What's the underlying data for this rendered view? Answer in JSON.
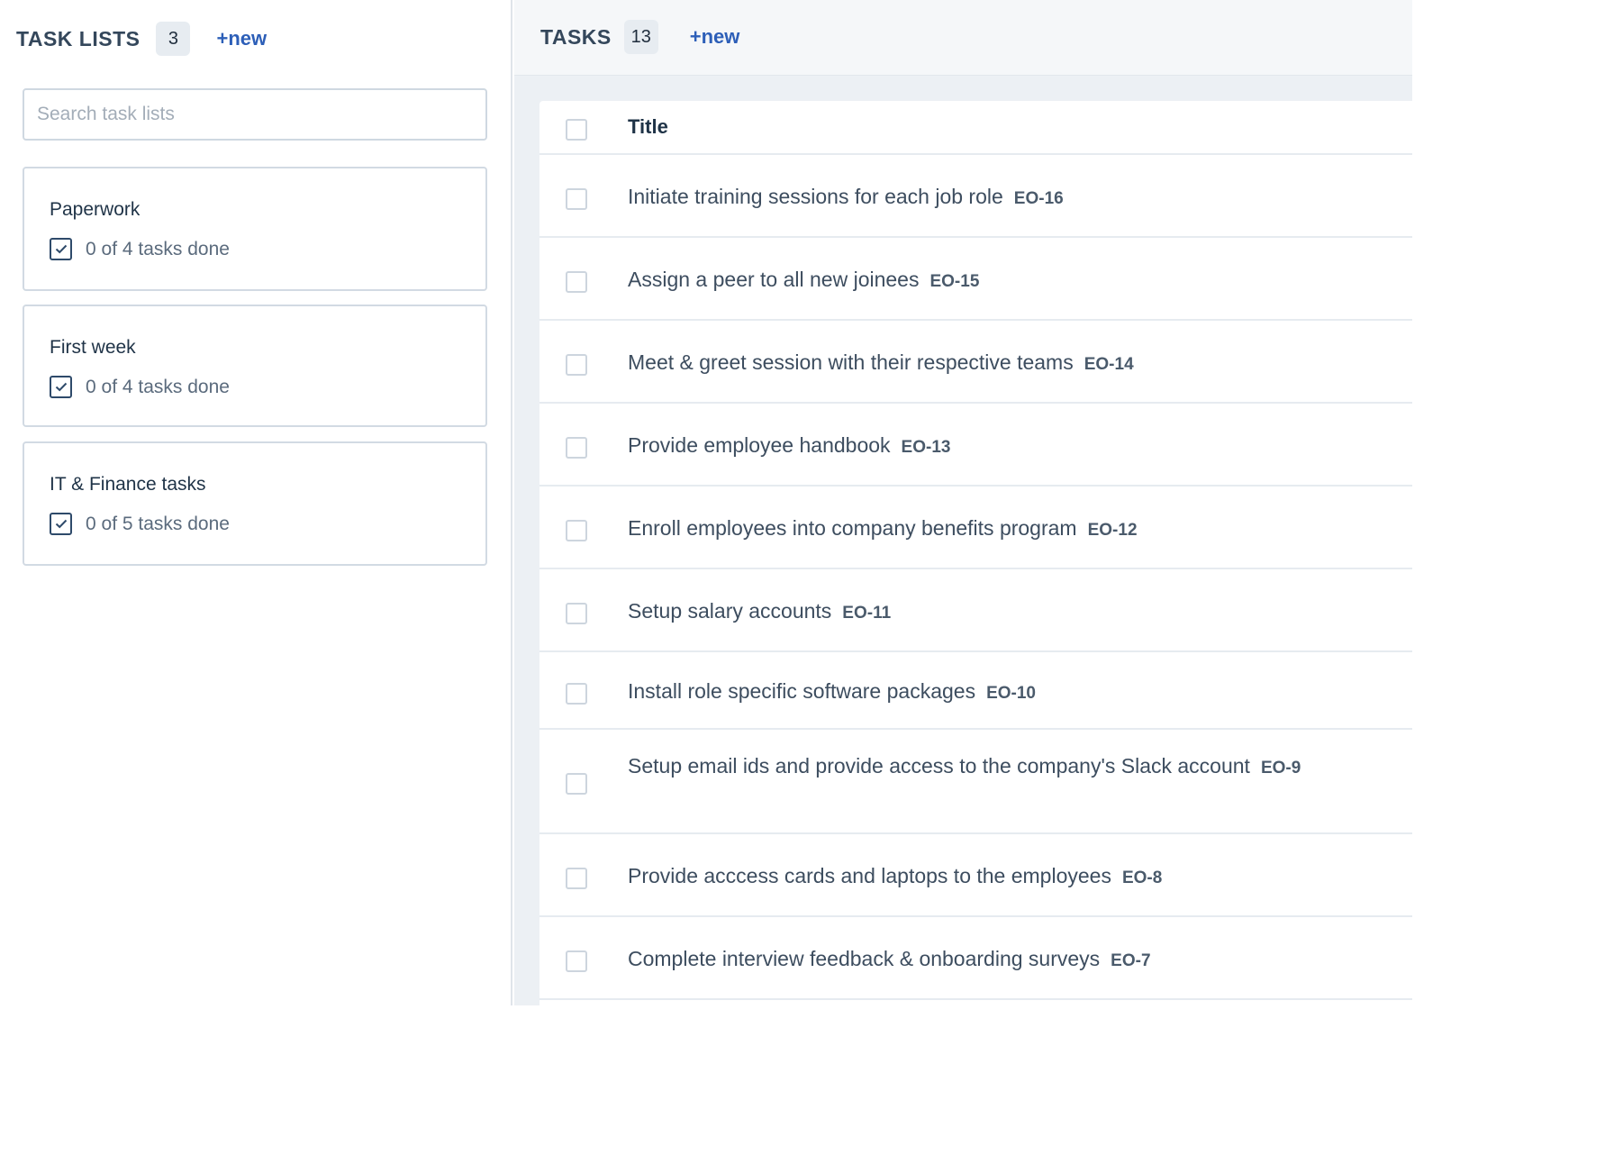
{
  "task_lists_panel": {
    "title": "TASK LISTS",
    "count": "3",
    "new_label": "+new",
    "search_placeholder": "Search task lists",
    "lists": [
      {
        "title": "Paperwork",
        "progress": "0 of 4 tasks done"
      },
      {
        "title": "First week",
        "progress": "0 of 4 tasks done"
      },
      {
        "title": "IT & Finance tasks",
        "progress": "0 of 5 tasks done"
      }
    ]
  },
  "tasks_panel": {
    "title": "TASKS",
    "count": "13",
    "new_label": "+new",
    "column_title": "Title",
    "tasks": [
      {
        "title": "Initiate training sessions for each job role",
        "id": "EO-16"
      },
      {
        "title": "Assign a peer to all new joinees",
        "id": "EO-15"
      },
      {
        "title": "Meet & greet session with their respective teams",
        "id": "EO-14"
      },
      {
        "title": "Provide employee handbook",
        "id": "EO-13"
      },
      {
        "title": "Enroll employees into company benefits program",
        "id": "EO-12"
      },
      {
        "title": "Setup salary accounts",
        "id": "EO-11"
      },
      {
        "title": "Install role specific software packages",
        "id": "EO-10"
      },
      {
        "title": "Setup email ids and provide access to the company's Slack account",
        "id": "EO-9"
      },
      {
        "title": "Provide acccess cards and laptops to the employees",
        "id": "EO-8"
      },
      {
        "title": "Complete interview feedback & onboarding surveys",
        "id": "EO-7"
      }
    ]
  },
  "icons": {
    "list_progress": "checkbox-checked-icon"
  },
  "colors": {
    "accent": "#2d5fb8",
    "text_dark": "#34475b",
    "panel_bg": "#ecf0f4"
  }
}
